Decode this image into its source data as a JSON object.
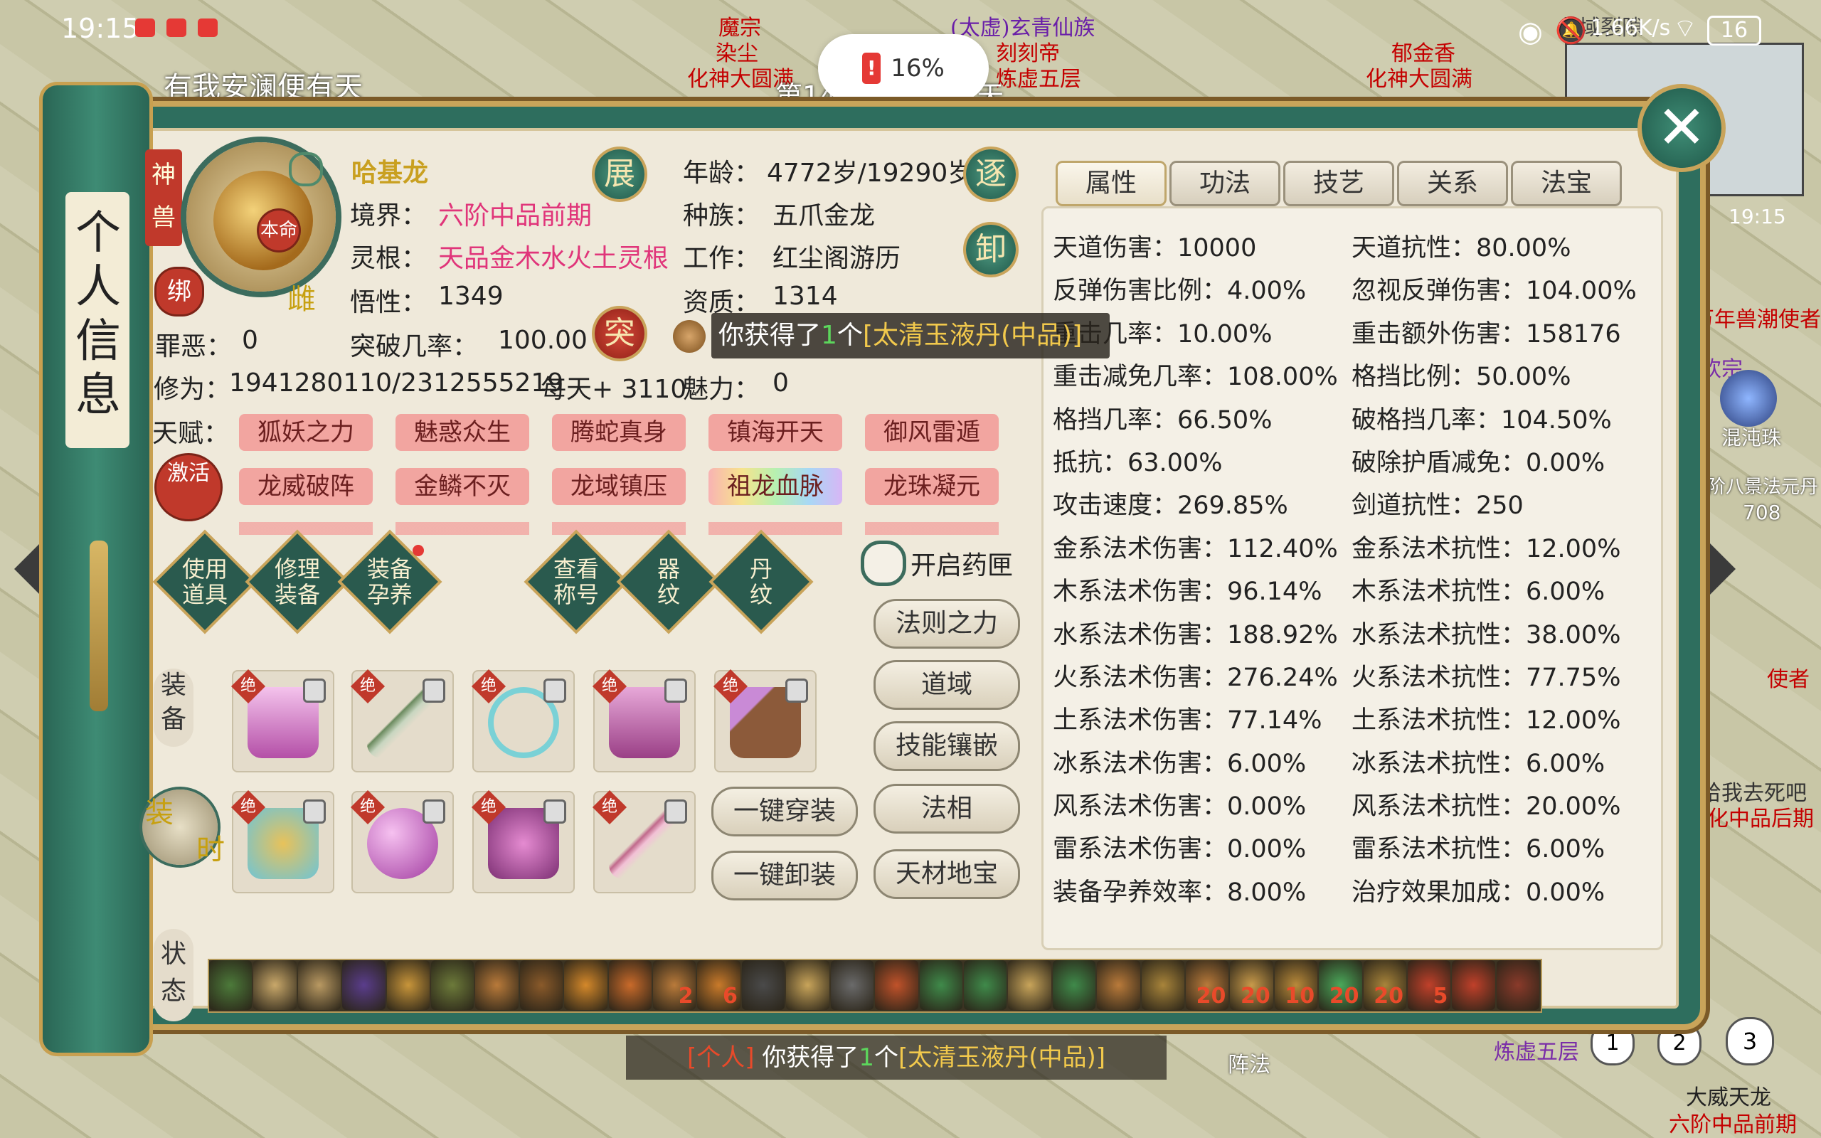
{
  "status_bar": {
    "time": "19:15",
    "network_speed": "1.66K/s",
    "battery": "16",
    "battery_popup": "16%"
  },
  "background": {
    "player_banner": "有我安澜便有天",
    "top_names": [
      "魔宗",
      "染尘",
      "化神大圆满",
      "(太虚)玄青仙族",
      "刻刻帝",
      "炼虚五层",
      "郁金香",
      "化神大圆满",
      "北域裂隙"
    ],
    "day_counter": "第1493年3月21天",
    "right_names": [
      "万年兽潮使者",
      "欢宗",
      "混沌珠",
      "阶八景法元丹",
      "708",
      "使者",
      "化中品后期",
      "给我去死吧"
    ],
    "minimap_time": "19:15",
    "bottom_right": [
      "炼虚五层",
      "大威天龙",
      "六阶中品前期"
    ],
    "bottom_center_label": "阵法",
    "page_numbers": [
      "1",
      "2",
      "3"
    ]
  },
  "panel_title": "个人信息",
  "close_label": "✕",
  "profile": {
    "category_tag": "神兽",
    "avatar_badge": "本命",
    "gender": "雌",
    "bind_label": "绑",
    "activate_label": "激活",
    "name": "哈基龙",
    "expand_label": "展",
    "evict_label": "逐",
    "unload_label": "卸",
    "breakthrough_label": "突",
    "realm_label": "境界：",
    "realm_value": "六阶中品前期",
    "root_label": "灵根：",
    "root_value": "天品金木水火土灵根",
    "insight_label": "悟性：",
    "insight_value": "1349",
    "break_rate_label": "突破几率：",
    "break_rate_value": "100.00",
    "age_label": "年龄：",
    "age_value": "4772岁/19290岁",
    "race_label": "种族：",
    "race_value": "五爪金龙",
    "job_label": "工作：",
    "job_value": "红尘阁游历",
    "aptitude_label": "资质：",
    "aptitude_value": "1314",
    "sin_label": "罪恶：",
    "sin_value": "0",
    "cultivation_label": "修为：",
    "cultivation_value": "1941280110/2312555219",
    "per_day": "每天+ 3110",
    "charm_label": "魅力：",
    "charm_value": "0",
    "talent_label": "天赋："
  },
  "talents": [
    "狐妖之力",
    "魅惑众生",
    "腾蛇真身",
    "镇海开天",
    "御风雷遁",
    "龙威破阵",
    "金鳞不灭",
    "龙域镇压",
    "祖龙血脉",
    "龙珠凝元"
  ],
  "actions": [
    {
      "label1": "使用",
      "label2": "道具"
    },
    {
      "label1": "修理",
      "label2": "装备"
    },
    {
      "label1": "装备",
      "label2": "孕养"
    },
    {
      "label1": "查看",
      "label2": "称号"
    },
    {
      "label1": "器",
      "label2": "纹"
    },
    {
      "label1": "丹",
      "label2": "纹"
    }
  ],
  "pill_box_toggle": "开启药匣",
  "side_buttons": [
    "法则之力",
    "道域",
    "技能镶嵌",
    "法相",
    "天材地宝"
  ],
  "equip_buttons": [
    "一键穿装",
    "一键卸装"
  ],
  "equip_label": "装备",
  "fashion_label": "装",
  "fashion_label2": "时",
  "status_label": "状态",
  "slot_badge": "绝",
  "tabs": [
    "属性",
    "功法",
    "技艺",
    "关系",
    "法宝"
  ],
  "stats_left": [
    "天道伤害：10000",
    "反弹伤害比例：4.00%",
    "重击几率：10.00%",
    "重击减免几率：108.00%",
    "格挡几率：66.50%",
    "抵抗：63.00%",
    "攻击速度：269.85%",
    "金系法术伤害：112.40%",
    "木系法术伤害：96.14%",
    "水系法术伤害：188.92%",
    "火系法术伤害：276.24%",
    "土系法术伤害：77.14%",
    "冰系法术伤害：6.00%",
    "风系法术伤害：0.00%",
    "雷系法术伤害：0.00%",
    "装备孕养效率：8.00%"
  ],
  "stats_right": [
    "天道抗性：80.00%",
    "忽视反弹伤害：104.00%",
    "重击额外伤害：158176",
    "格挡比例：50.00%",
    "破格挡几率：104.50%",
    "破除护盾减免：0.00%",
    "剑道抗性：250",
    "金系法术抗性：12.00%",
    "木系法术抗性：6.00%",
    "水系法术抗性：38.00%",
    "火系法术抗性：77.75%",
    "土系法术抗性：12.00%",
    "冰系法术抗性：6.00%",
    "风系法术抗性：20.00%",
    "雷系法术抗性：6.00%",
    "治疗效果加成：0.00%"
  ],
  "buff_counts": [
    "",
    "",
    "",
    "",
    "",
    "",
    "",
    "",
    "",
    "",
    "2",
    "6",
    "",
    "",
    "",
    "",
    "",
    "",
    "",
    "",
    "",
    "",
    "20",
    "20",
    "10",
    "20",
    "20",
    "5",
    "",
    ""
  ],
  "toast": {
    "prefix": "你获得了",
    "count": "1",
    "mid": "个",
    "item": "[太清玉液丹(中品)]"
  },
  "chat_message": {
    "channel": "[个人]",
    "prefix": "你获得了",
    "count": "1",
    "mid": "个",
    "item": "[太清玉液丹(中品)]"
  },
  "colors": {
    "panel": "#2e6e5e",
    "gold": "#c9a45a",
    "talent": "#f2a5a0",
    "accent_pink": "#e0357a"
  }
}
